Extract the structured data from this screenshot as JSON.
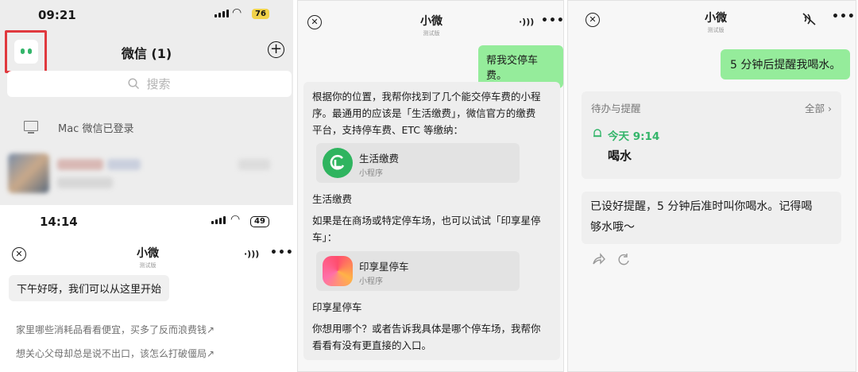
{
  "panel1": {
    "top_status": {
      "time": "09:21",
      "battery": "76"
    },
    "title": "微信 (1)",
    "search_placeholder": "搜索",
    "mac_login": "Mac 微信已登录",
    "bottom_status": {
      "time": "14:14",
      "battery": "49"
    },
    "bot_header": {
      "title": "小微",
      "subtitle": "测试版"
    },
    "greeting": "下午好呀，我们可以从这里开始",
    "suggestions": [
      "家里哪些消耗品看看便宜，买多了反而浪费钱↗",
      "想关心父母却总是说不出口，该怎么打破僵局↗"
    ]
  },
  "panel2": {
    "header": {
      "title": "小微",
      "subtitle": "测试版"
    },
    "user_message": "帮我交停车费。",
    "reply_intro": [
      "根据你的位置，我帮你找到了几个能交停车费的小程",
      "序。最通用的应该是「生活缴费」，微信官方的缴费",
      "平台，支持停车费、ETC 等缴纳："
    ],
    "card1": {
      "name": "生活缴费",
      "type": "小程序"
    },
    "card1_label": "生活缴费",
    "reply_mid": [
      "如果是在商场或特定停车场，也可以试试「印享星停",
      "车」："
    ],
    "card2": {
      "name": "印享星停车",
      "type": "小程序"
    },
    "card2_label": "印享星停车",
    "reply_end": [
      "你想用哪个？或者告诉我具体是哪个停车场，我帮你",
      "看看有没有更直接的入口。"
    ]
  },
  "panel3": {
    "header": {
      "title": "小微",
      "subtitle": "测试版"
    },
    "user_message": "5 分钟后提醒我喝水。",
    "todo": {
      "heading": "待办与提醒",
      "all": "全部 ›",
      "time": "今天 9:14",
      "item": "喝水"
    },
    "reply": [
      "已设好提醒，5 分钟后准时叫你喝水。记得喝",
      "够水哦～"
    ]
  },
  "colors": {
    "accent_green": "#34b56a",
    "bubble_green": "#95ec9b",
    "highlight_red": "#e0393e",
    "battery_yellow": "#f2d24a"
  },
  "icons": [
    "signal-icon",
    "wifi-icon",
    "battery-icon",
    "mini-program-icon",
    "plus-icon",
    "search-icon",
    "monitor-icon",
    "close-icon",
    "speaker-icon",
    "speaker-muted-icon",
    "more-icon",
    "bell-icon",
    "share-icon",
    "refresh-icon"
  ]
}
